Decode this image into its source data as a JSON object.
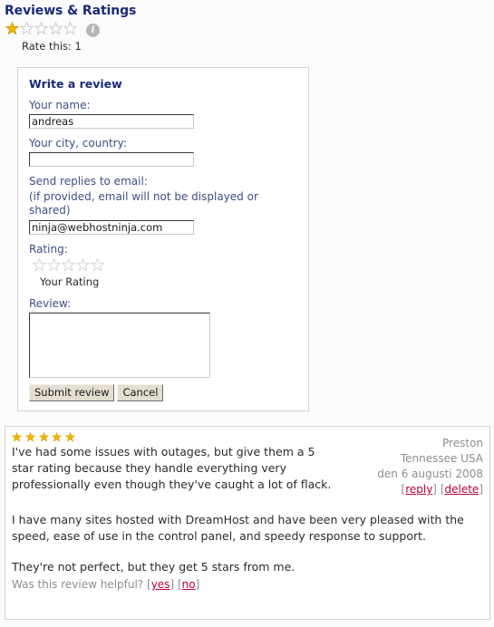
{
  "header": {
    "title": "Reviews & Ratings",
    "rating_value": 1,
    "rating_max": 5,
    "rate_this_label": "Rate this: 1",
    "info_icon_glyph": "i",
    "info_icon_name": "info-icon"
  },
  "form": {
    "heading": "Write a review",
    "name_label": "Your name:",
    "name_value": "andreas",
    "name_placeholder": "",
    "city_label": "Your city, country:",
    "city_value": "",
    "city_placeholder": "",
    "email_label": "Send replies to email:",
    "email_note": "(if provided, email will not be displayed or shared)",
    "email_value": "ninja@webhostninja.com",
    "email_placeholder": "",
    "rating_label": "Rating:",
    "rating_value": 0,
    "rating_max": 5,
    "your_rating_label": "Your Rating",
    "review_label": "Review:",
    "review_value": "",
    "review_placeholder": "",
    "submit_label": "Submit review",
    "cancel_label": "Cancel"
  },
  "review": {
    "stars": 5,
    "stars_max": 5,
    "paragraph_1": "I've had some issues with outages, but give them a 5 star rating because they handle everything very professionally even though they've caught a lot of flack.",
    "paragraph_2": "I have many sites hosted with DreamHost and have been very pleased with the speed, ease of use in the control panel, and speedy response to support.",
    "paragraph_3": "They're not perfect, but they get 5 stars from me.",
    "author": "Preston",
    "location": "Tennessee USA",
    "date": "den 6 augusti 2008",
    "reply_label": "reply",
    "delete_label": "delete",
    "helpful_question": "Was this review helpful?",
    "helpful_yes": "yes",
    "helpful_no": "no",
    "bracket_open": "[",
    "bracket_close": "]"
  },
  "colors": {
    "title_blue": "#1b2a78",
    "label_blue": "#3d4f86",
    "star_gold": "#f4b400",
    "star_empty": "#cfcfcf",
    "link_red": "#bb0033",
    "meta_gray": "#8d8d8d",
    "page_bg": "#fbfbfb",
    "box_border": "#d3d3d3"
  }
}
